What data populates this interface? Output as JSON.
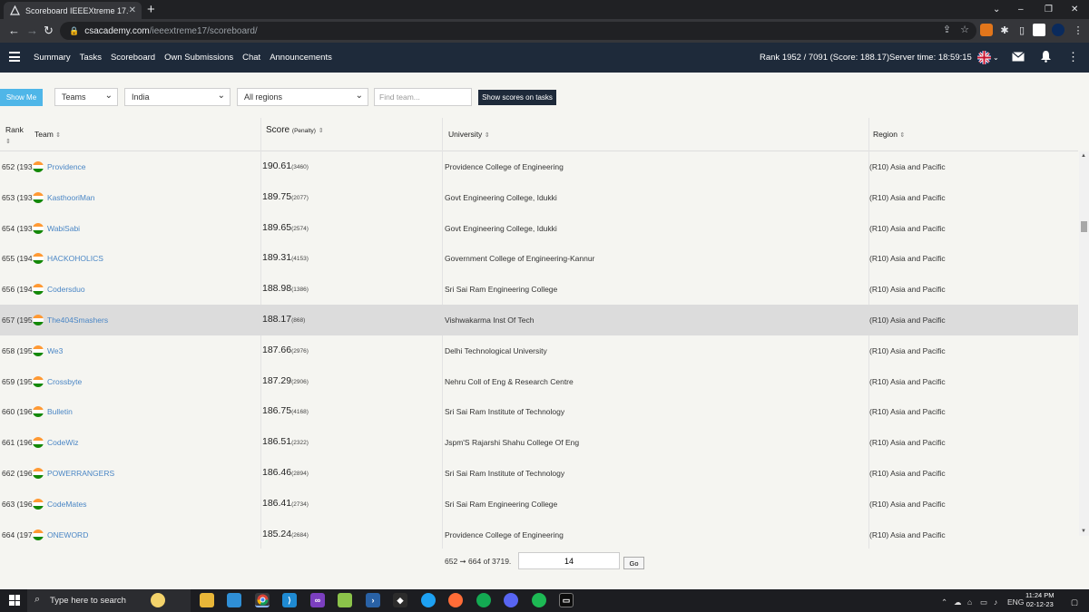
{
  "browser": {
    "tab_title": "Scoreboard IEEEXtreme 17.0",
    "url_host": "csacademy.com",
    "url_path": "/ieeextreme17/scoreboard/"
  },
  "header": {
    "nav": [
      "Summary",
      "Tasks",
      "Scoreboard",
      "Own Submissions",
      "Chat",
      "Announcements"
    ],
    "rank_info": "Rank 1952 / 7091 (Score: 188.17)",
    "server_time": "Server time: 18:59:15"
  },
  "filters": {
    "show_me": "Show Me",
    "type": "Teams",
    "country": "India",
    "region": "All regions",
    "find_placeholder": "Find team...",
    "show_scores": "Show scores on tasks"
  },
  "table": {
    "headers": {
      "rank": "Rank",
      "team": "Team",
      "score": "Score",
      "penalty": "(Penalty)",
      "university": "University",
      "region": "Region"
    },
    "rows": [
      {
        "rank": "652 (193",
        "team": "Providence",
        "score": "190.61",
        "penalty": "(3460)",
        "university": "Providence College of Engineering",
        "region": "(R10) Asia and Pacific"
      },
      {
        "rank": "653 (193",
        "team": "KasthooriMan",
        "score": "189.75",
        "penalty": "(2077)",
        "university": "Govt Engineering College, Idukki",
        "region": "(R10) Asia and Pacific"
      },
      {
        "rank": "654 (193",
        "team": "WabiSabi",
        "score": "189.65",
        "penalty": "(2574)",
        "university": "Govt Engineering College, Idukki",
        "region": "(R10) Asia and Pacific"
      },
      {
        "rank": "655 (194",
        "team": "HACKOHOLICS",
        "score": "189.31",
        "penalty": "(4153)",
        "university": "Government College of Engineering-Kannur",
        "region": "(R10) Asia and Pacific"
      },
      {
        "rank": "656 (194",
        "team": "Codersduo",
        "score": "188.98",
        "penalty": "(1386)",
        "university": "Sri Sai Ram Engineering College",
        "region": "(R10) Asia and Pacific"
      },
      {
        "rank": "657 (195",
        "team": "The404Smashers",
        "score": "188.17",
        "penalty": "(868)",
        "university": "Vishwakarma Inst Of Tech",
        "region": "(R10) Asia and Pacific"
      },
      {
        "rank": "658 (195",
        "team": "We3",
        "score": "187.66",
        "penalty": "(2976)",
        "university": "Delhi Technological University",
        "region": "(R10) Asia and Pacific"
      },
      {
        "rank": "659 (195",
        "team": "Crossbyte",
        "score": "187.29",
        "penalty": "(2906)",
        "university": "Nehru Coll of Eng & Research Centre",
        "region": "(R10) Asia and Pacific"
      },
      {
        "rank": "660 (196",
        "team": "Bulletin",
        "score": "186.75",
        "penalty": "(4168)",
        "university": "Sri Sai Ram Institute of Technology",
        "region": "(R10) Asia and Pacific"
      },
      {
        "rank": "661 (196",
        "team": "CodeWiz",
        "score": "186.51",
        "penalty": "(2322)",
        "university": "Jspm'S Rajarshi Shahu College Of Eng",
        "region": "(R10) Asia and Pacific"
      },
      {
        "rank": "662 (196",
        "team": "POWERRANGERS",
        "score": "186.46",
        "penalty": "(2894)",
        "university": "Sri Sai Ram Institute of Technology",
        "region": "(R10) Asia and Pacific"
      },
      {
        "rank": "663 (196",
        "team": "CodeMates",
        "score": "186.41",
        "penalty": "(2734)",
        "university": "Sri Sai Ram Engineering College",
        "region": "(R10) Asia and Pacific"
      },
      {
        "rank": "664 (197",
        "team": "ONEWORD",
        "score": "185.24",
        "penalty": "(2684)",
        "university": "Providence College of Engineering",
        "region": "(R10) Asia and Pacific"
      }
    ]
  },
  "pagination": {
    "summary": "652 ➞ 664 of 3719.",
    "page": "14",
    "go": "Go"
  },
  "taskbar": {
    "search_placeholder": "Type here to search",
    "lang": "ENG",
    "time": "11:24 PM",
    "date": "02-12-23"
  }
}
